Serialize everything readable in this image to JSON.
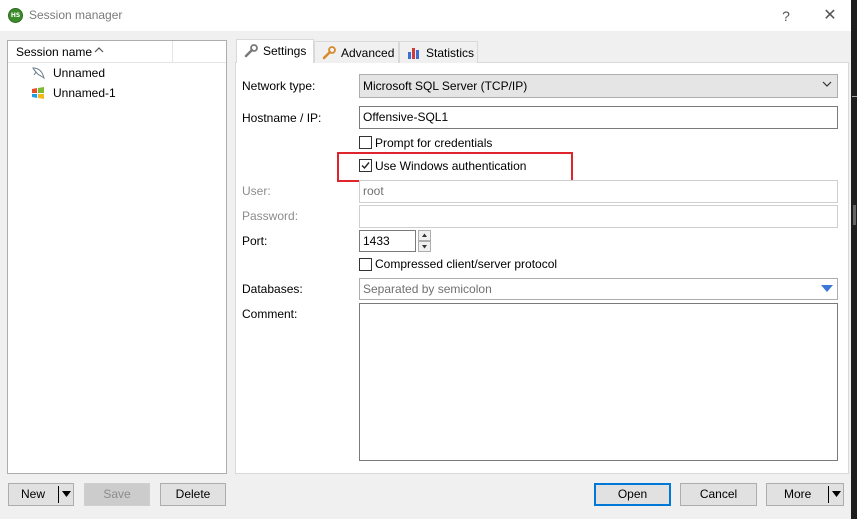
{
  "window": {
    "title": "Session manager",
    "app_icon_text": "HS",
    "help_glyph": "?",
    "close_glyph": "✕"
  },
  "session_list": {
    "header": "Session name",
    "sessions": [
      {
        "name": "Unnamed",
        "icon": "dolphin-icon"
      },
      {
        "name": "Unnamed-1",
        "icon": "windows-flag-icon"
      }
    ]
  },
  "tabs": [
    {
      "label": "Settings",
      "icon": "wrench-icon",
      "active": true
    },
    {
      "label": "Advanced",
      "icon": "wrench-orange-icon",
      "active": false
    },
    {
      "label": "Statistics",
      "icon": "bar-chart-icon",
      "active": false
    }
  ],
  "settings": {
    "network_type": {
      "label": "Network type:",
      "value": "Microsoft SQL Server (TCP/IP)"
    },
    "hostname": {
      "label": "Hostname / IP:",
      "value": "Offensive-SQL1"
    },
    "prompt_credentials": {
      "label": "Prompt for credentials",
      "checked": false
    },
    "windows_auth": {
      "label": "Use Windows authentication",
      "checked": true
    },
    "user": {
      "label": "User:",
      "value": "root"
    },
    "password": {
      "label": "Password:",
      "value": ""
    },
    "port": {
      "label": "Port:",
      "value": "1433"
    },
    "compressed": {
      "label": "Compressed client/server protocol",
      "checked": false
    },
    "databases": {
      "label": "Databases:",
      "placeholder": "Separated by semicolon"
    },
    "comment": {
      "label": "Comment:",
      "value": ""
    }
  },
  "buttons": {
    "new": "New",
    "save": "Save",
    "delete": "Delete",
    "open": "Open",
    "cancel": "Cancel",
    "more": "More"
  },
  "colors": {
    "highlight": "#e0242c",
    "default_button_border": "#0078d7"
  }
}
